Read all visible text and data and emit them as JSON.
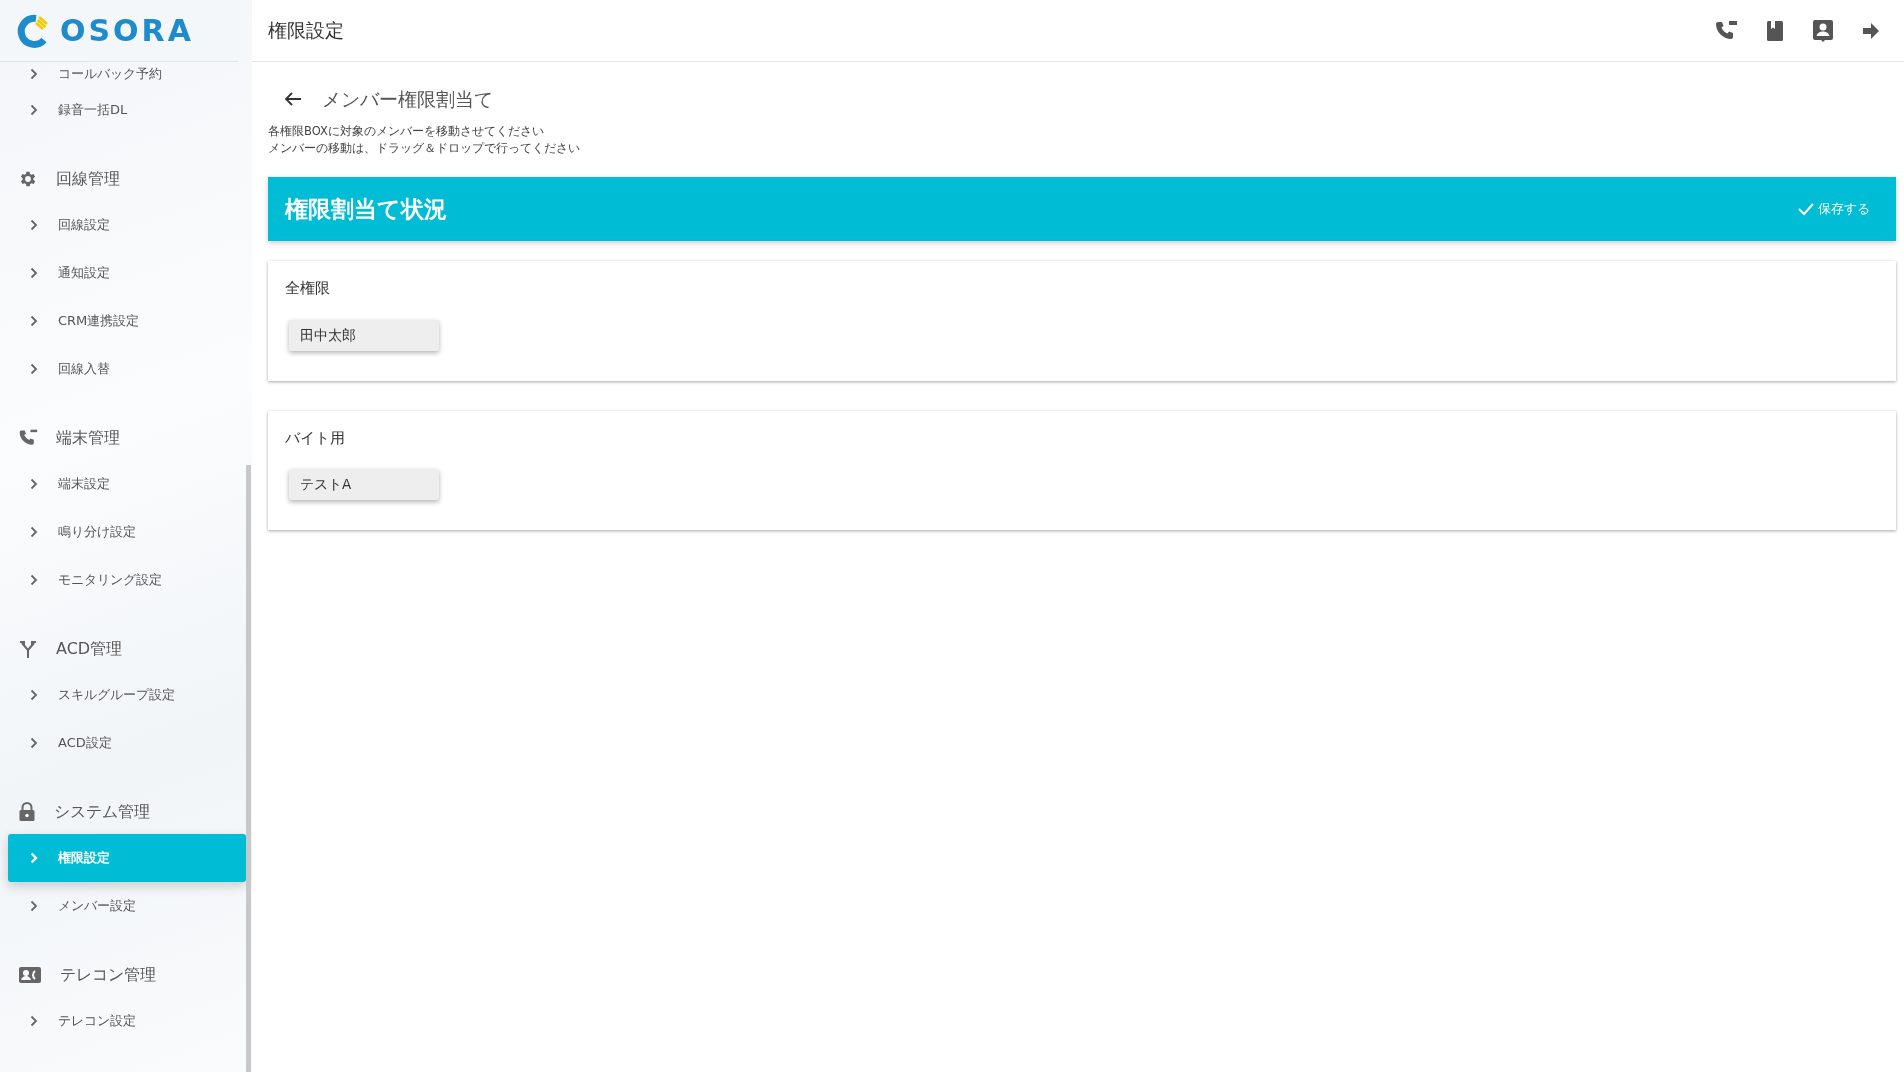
{
  "app": {
    "logo_text": "OSORA"
  },
  "sidebar": {
    "sections": [
      {
        "items": [
          {
            "label": "コールバック予約",
            "selected": false
          },
          {
            "label": "録音一括DL",
            "selected": false
          }
        ]
      },
      {
        "title": "回線管理",
        "items": [
          {
            "label": "回線設定",
            "selected": false
          },
          {
            "label": "通知設定",
            "selected": false
          },
          {
            "label": "CRM連携設定",
            "selected": false
          },
          {
            "label": "回線入替",
            "selected": false
          }
        ]
      },
      {
        "title": "端末管理",
        "items": [
          {
            "label": "端末設定",
            "selected": false
          },
          {
            "label": "鳴り分け設定",
            "selected": false
          },
          {
            "label": "モニタリング設定",
            "selected": false
          }
        ]
      },
      {
        "title": "ACD管理",
        "items": [
          {
            "label": "スキルグループ設定",
            "selected": false
          },
          {
            "label": "ACD設定",
            "selected": false
          }
        ]
      },
      {
        "title": "システム管理",
        "items": [
          {
            "label": "権限設定",
            "selected": true
          },
          {
            "label": "メンバー設定",
            "selected": false
          }
        ]
      },
      {
        "title": "テレコン管理",
        "items": [
          {
            "label": "テレコン設定",
            "selected": false
          }
        ]
      }
    ]
  },
  "header": {
    "title": "権限設定"
  },
  "page": {
    "title": "メンバー権限割当て",
    "instructions": [
      "各権限BOXに対象のメンバーを移動させてください",
      "メンバーの移動は、ドラッグ＆ドロップで行ってください"
    ]
  },
  "panel": {
    "title": "権限割当て状況",
    "save_button": "保存する"
  },
  "roles": [
    {
      "name": "全権限",
      "members": [
        "田中太郎"
      ]
    },
    {
      "name": "バイト用",
      "members": [
        "テストA"
      ]
    }
  ]
}
